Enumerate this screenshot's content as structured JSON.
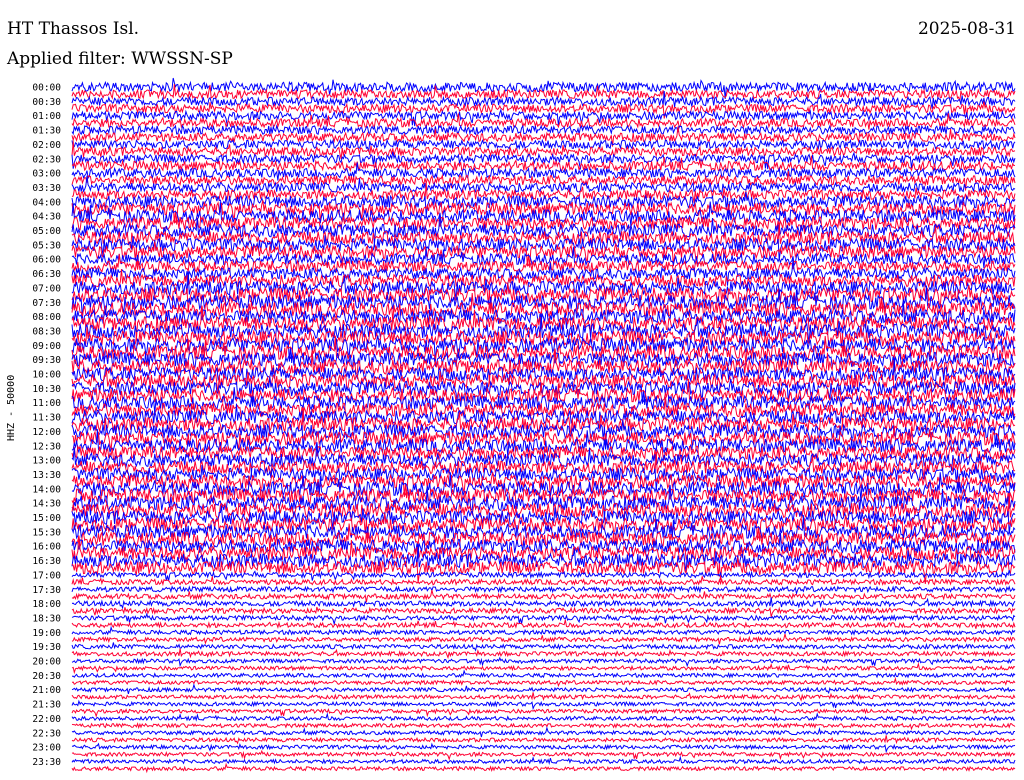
{
  "header": {
    "station": "HT Thassos Isl.",
    "date": "2025-08-31",
    "filter": "Applied filter: WWSSN-SP"
  },
  "channel_label": "HHZ - 50000",
  "colors": {
    "trace_a": "#0000ff",
    "trace_b": "#ff0033",
    "label": "#000000",
    "background": "#ffffff"
  },
  "chart_data": {
    "type": "line",
    "title": "HT Thassos Isl.",
    "subtitle": "Applied filter: WWSSN-SP",
    "ylabel": "HHZ - 50000",
    "xlabel": "",
    "grid": false,
    "legend": "none",
    "trace_interval_minutes": 15,
    "row_labels": [
      "00:00",
      "00:30",
      "01:00",
      "01:30",
      "02:00",
      "02:30",
      "03:00",
      "03:30",
      "04:00",
      "04:30",
      "05:00",
      "05:30",
      "06:00",
      "06:30",
      "07:00",
      "07:30",
      "08:00",
      "08:30",
      "09:00",
      "09:30",
      "10:00",
      "10:30",
      "11:00",
      "11:30",
      "12:00",
      "12:30",
      "13:00",
      "13:30",
      "14:00",
      "14:30",
      "15:00",
      "15:30",
      "16:00",
      "16:30",
      "17:00",
      "17:30",
      "18:00",
      "18:30",
      "19:00",
      "19:30",
      "20:00",
      "20:30",
      "21:00",
      "21:30",
      "22:00",
      "22:30",
      "23:00",
      "23:30"
    ],
    "series": [
      {
        "values": [
          1.1,
          1.0,
          1.0,
          1.0,
          1.0,
          1.0,
          1.1,
          1.1,
          1.4,
          1.5,
          1.5,
          1.5,
          1.3,
          1.3,
          1.6,
          1.7,
          1.7,
          1.7,
          1.7,
          1.7,
          1.6,
          1.6,
          1.6,
          1.6,
          1.6,
          1.6,
          1.5,
          1.5,
          1.7,
          1.7,
          1.6,
          1.6,
          1.6,
          1.6,
          0.6,
          0.6,
          0.6,
          0.55,
          0.5,
          0.5,
          0.45,
          0.45,
          0.45,
          0.45,
          0.45,
          0.45,
          0.45,
          0.45
        ]
      },
      {
        "values": [
          1.0,
          1.0,
          1.0,
          1.0,
          1.0,
          1.1,
          1.1,
          1.1,
          1.5,
          1.5,
          1.5,
          1.5,
          1.3,
          1.4,
          1.7,
          1.7,
          1.7,
          1.7,
          1.7,
          1.7,
          1.6,
          1.6,
          1.6,
          1.6,
          1.6,
          1.6,
          1.5,
          1.6,
          1.7,
          1.7,
          1.6,
          1.6,
          1.6,
          1.5,
          0.6,
          0.6,
          0.6,
          0.55,
          0.5,
          0.5,
          0.45,
          0.45,
          0.45,
          0.45,
          0.45,
          0.45,
          0.45,
          0.45
        ]
      }
    ]
  }
}
